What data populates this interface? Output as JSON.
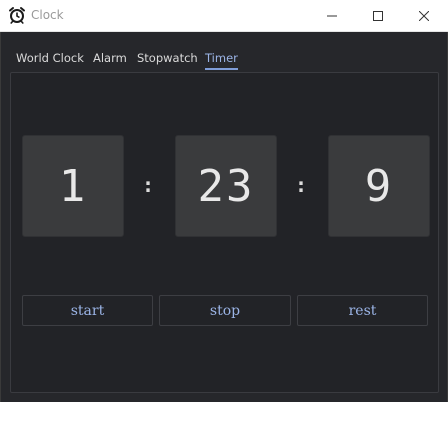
{
  "window": {
    "title": "Clock",
    "app_icon": "alarm-clock-icon",
    "controls": [
      "minimize-icon",
      "maximize-icon",
      "close-icon"
    ]
  },
  "tabs": [
    {
      "label": "World Clock",
      "active": false
    },
    {
      "label": "Alarm",
      "active": false
    },
    {
      "label": "Stopwatch",
      "active": false
    },
    {
      "label": "Timer",
      "active": true
    }
  ],
  "timer": {
    "hours": "1",
    "minutes": "23",
    "seconds": "9",
    "separator": ":"
  },
  "actions": {
    "start_label": "start",
    "stop_label": "stop",
    "reset_label": "rest"
  },
  "colors": {
    "background": "#26272b",
    "accent": "#9bb4e6",
    "digit_box": "#3a3b3d"
  }
}
